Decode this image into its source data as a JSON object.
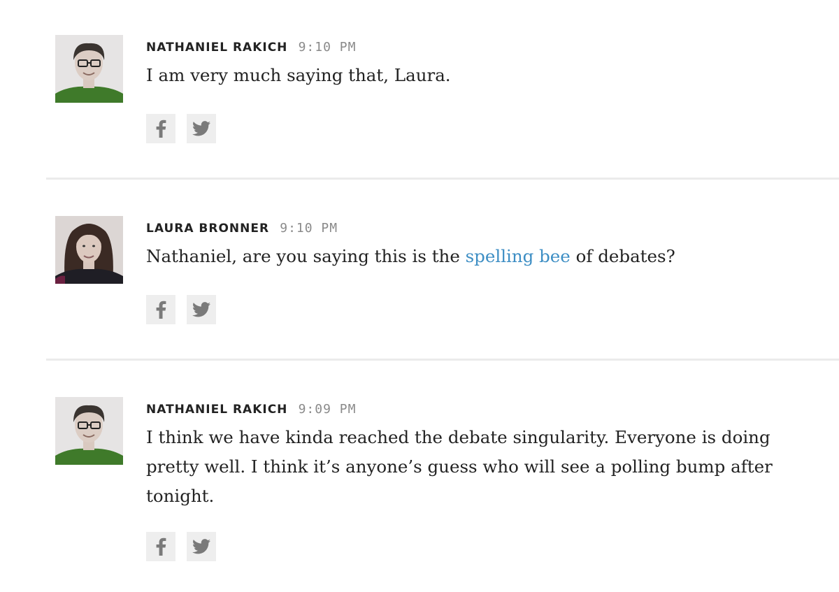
{
  "posts": [
    {
      "author": "NATHANIEL RAKICH",
      "time": "9:10 PM",
      "body": "I am very much saying that, Laura."
    },
    {
      "author": "LAURA BRONNER",
      "time": "9:10 PM",
      "body_before": "Nathaniel, are you saying this is the ",
      "body_link": "spelling bee",
      "body_after": " of debates?"
    },
    {
      "author": "NATHANIEL RAKICH",
      "time": "9:09 PM",
      "body_lines": [
        "I think we have kinda reached the debate singularity. Everyone is doing",
        "pretty well. I think it’s anyone’s guess who will see a polling bump after",
        "tonight."
      ]
    }
  ],
  "share": {
    "facebook_icon": "facebook-icon",
    "twitter_icon": "twitter-icon"
  },
  "colors": {
    "link": "#3d8ec4",
    "time": "#8a8a8a",
    "share_bg": "#eeeeee",
    "divider": "#ebebeb"
  }
}
